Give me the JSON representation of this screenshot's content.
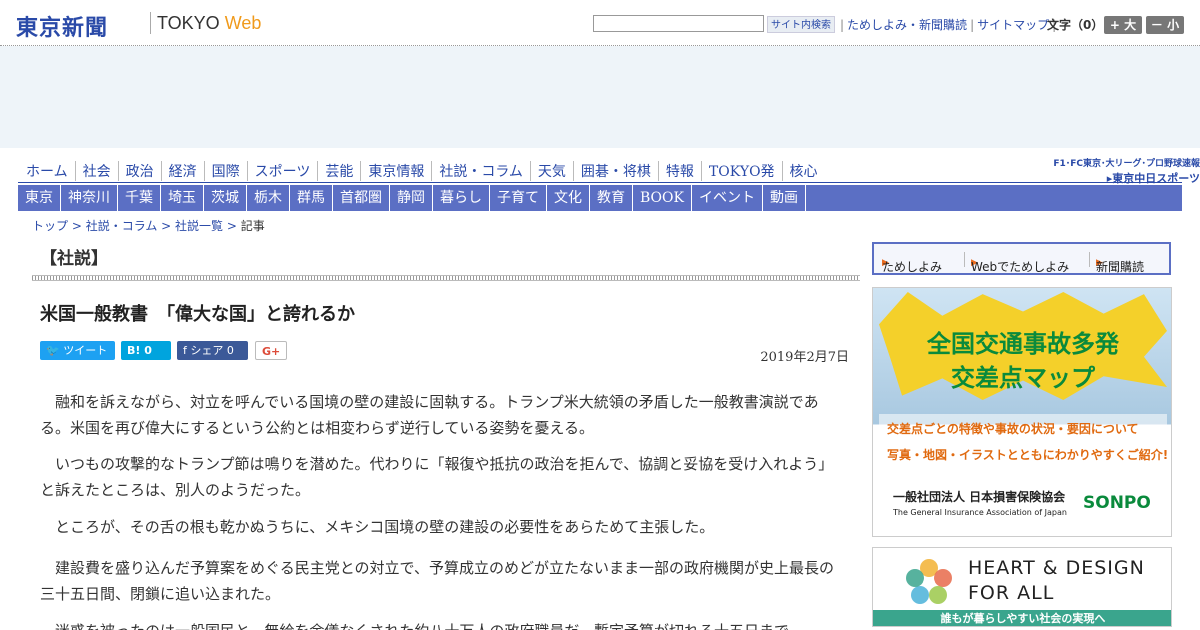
{
  "header": {
    "logo_text": "東京新聞",
    "logo_sub_a": "TOKYO",
    "logo_sub_b": "Web",
    "search_placeholder": "",
    "search_button": "サイト内検索",
    "links": [
      "ためしよみ・新聞購読",
      "サイトマップ"
    ],
    "font_label": "文字（0）",
    "font_larger": "+ 大",
    "font_smaller": "－ 小"
  },
  "global_nav": [
    "ホーム",
    "社会",
    "政治",
    "経済",
    "国際",
    "スポーツ",
    "芸能",
    "東京情報",
    "社説・コラム",
    "天気",
    "囲碁・将棋",
    "特報",
    "TOKYO発",
    "核心"
  ],
  "chunichi": {
    "line1": "F1･FC東京･大リーグ･プロ野球速報",
    "line2": "▸東京中日スポーツ"
  },
  "local_nav": [
    "東京",
    "神奈川",
    "千葉",
    "埼玉",
    "茨城",
    "栃木",
    "群馬",
    "首都圏",
    "静岡",
    "暮らし",
    "子育て",
    "文化",
    "教育",
    "BOOK",
    "イベント",
    "動画"
  ],
  "breadcrumb": {
    "items": [
      "トップ",
      "社説・コラム",
      "社説一覧"
    ],
    "sep": " > ",
    "current": "記事"
  },
  "section_title": "【社説】",
  "article": {
    "title": "米国一般教書　「偉大な国」と誇れるか",
    "date": "2019年2月7日",
    "share": {
      "tweet": "ツイート",
      "hatena": "B!  0",
      "facebook": "f  シェア 0",
      "gplus": "G+"
    },
    "paragraphs": [
      "融和を訴えながら、対立を呼んでいる国境の壁の建設に固執する。トランプ米大統領の矛盾した一般教書演説である。米国を再び偉大にするという公約とは相変わらず逆行している姿勢を憂える。",
      "いつもの攻撃的なトランプ節は鳴りを潜めた。代わりに「報復や抵抗の政治を拒んで、協調と妥協を受け入れよう」と訴えたところは、別人のようだった。",
      "ところが、その舌の根も乾かぬうちに、メキシコ国境の壁の建設の必要性をあらためて主張した。",
      "建設費を盛り込んだ予算案をめぐる民主党との対立で、予算成立のめどが立たないまま一部の政府機関が史上最長の三十五日間、閉鎖に追い込まれた。",
      "迷惑を被ったのは一般国民と、無給を余儀なくされた約八十万人の政府職員だ。暫定予算が切れる十五日まで"
    ]
  },
  "sidebar": {
    "links": [
      "ためしよみ",
      "Webでためしよみ",
      "新聞購読"
    ],
    "ad1": {
      "title1": "全国交通事故多発",
      "title2": "交差点マップ",
      "sub1": "交差点ごとの特徴や事故の状況・要因について",
      "sub2": "写真・地図・イラストとともにわかりやすくご紹介!",
      "org": "一般社団法人 日本損害保険協会",
      "org_en": "The General Insurance Association of Japan",
      "brand": "SONPO"
    },
    "ad2": {
      "line1": "HEART & DESIGN",
      "line2": "FOR ALL",
      "caption": "誰もが暮らしやすい社会の実現へ"
    }
  }
}
